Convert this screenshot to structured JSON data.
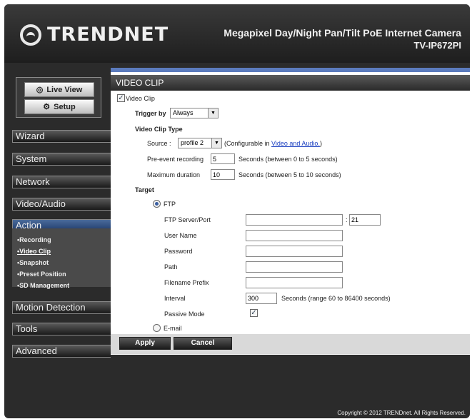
{
  "header": {
    "brand": "TRENDNET",
    "product_title": "Megapixel Day/Night Pan/Tilt PoE Internet Camera",
    "model": "TV-IP672PI"
  },
  "sidebar": {
    "live_view": "Live View",
    "setup": "Setup",
    "menu": [
      {
        "label": "Wizard"
      },
      {
        "label": "System"
      },
      {
        "label": "Network"
      },
      {
        "label": "Video/Audio"
      },
      {
        "label": "Action"
      },
      {
        "label": "Motion Detection"
      },
      {
        "label": "Tools"
      },
      {
        "label": "Advanced"
      }
    ],
    "submenu": [
      {
        "label": "•Recording"
      },
      {
        "label": "•Video Clip"
      },
      {
        "label": "•Snapshot"
      },
      {
        "label": "•Preset Position"
      },
      {
        "label": "•SD Management"
      }
    ]
  },
  "content": {
    "section_title": "VIDEO CLIP",
    "video_clip_label": "Video Clip",
    "video_clip_checked": true,
    "trigger_by_label": "Trigger by",
    "trigger_by_value": "Always",
    "clip_type_label": "Video Clip Type",
    "source_label": "Source :",
    "source_value": "profile 2",
    "configurable_prefix": "(Configurable in ",
    "configurable_link": "Video and Audio.",
    "configurable_suffix": ")",
    "pre_event_label": "Pre-event recording",
    "pre_event_value": "5",
    "pre_event_hint": "Seconds  (between 0 to 5 seconds)",
    "max_duration_label": "Maximum duration",
    "max_duration_value": "10",
    "max_duration_hint": "Seconds  (between 5 to 10 seconds)",
    "target_label": "Target",
    "ftp_label": "FTP",
    "ftp_server_label": "FTP Server/Port",
    "ftp_server_value": "",
    "port_separator": ":",
    "ftp_port_value": "21",
    "user_name_label": "User Name",
    "password_label": "Password",
    "path_label": "Path",
    "filename_prefix_label": "Filename Prefix",
    "interval_label": "Interval",
    "interval_value": "300",
    "interval_hint": "Seconds  (range 60 to 86400 seconds)",
    "passive_mode_label": "Passive Mode",
    "passive_mode_checked": true,
    "email_label": "E-mail",
    "apply_label": "Apply",
    "cancel_label": "Cancel"
  },
  "footer": {
    "copyright": "Copyright © 2012 TRENDnet. All Rights Reserved."
  },
  "colors": {
    "accent": "#5b7bbd",
    "background": "#2b2b2b",
    "link": "#1a3fc0"
  }
}
